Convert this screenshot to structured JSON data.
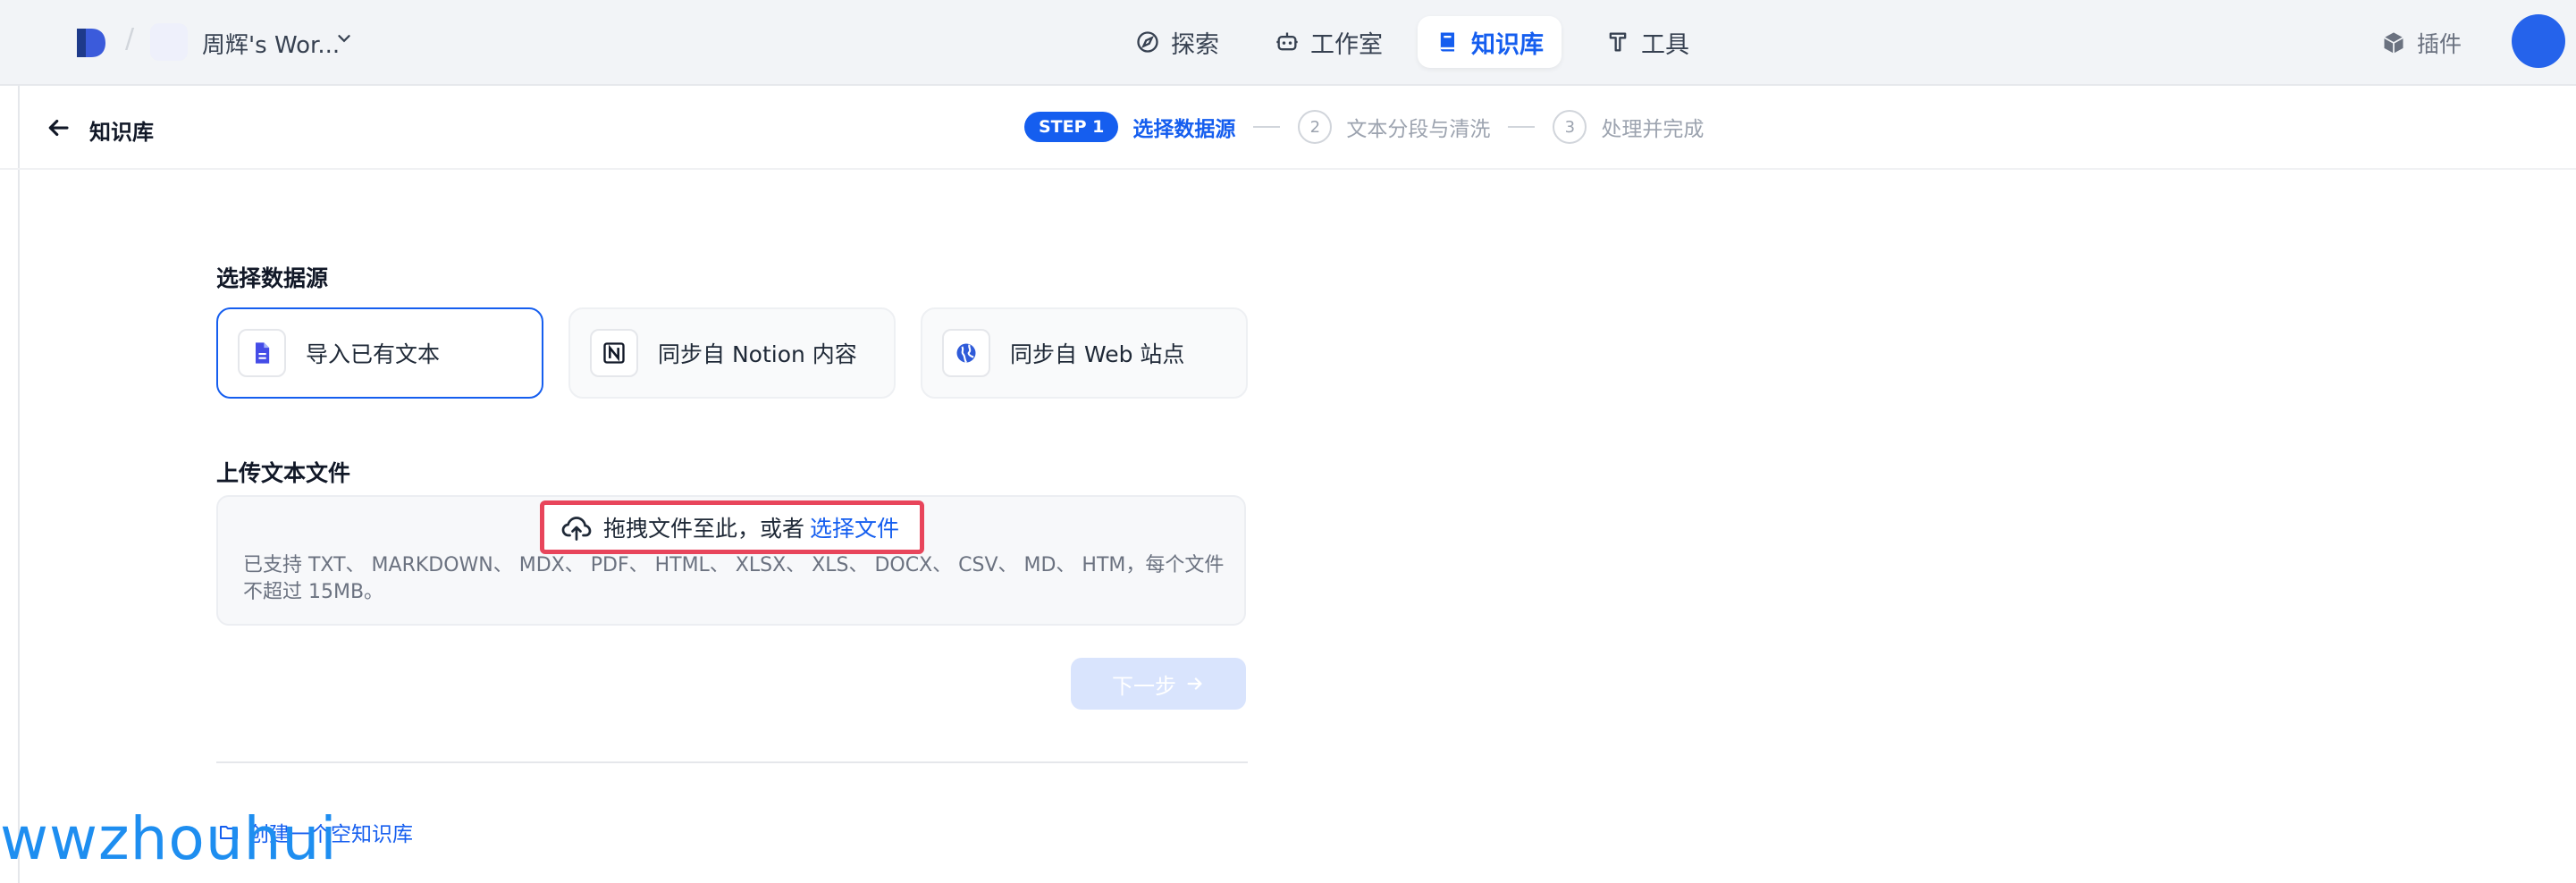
{
  "header": {
    "workspace_name": "周辉's Wor...",
    "nav": [
      {
        "label": "探索",
        "icon": "compass-icon"
      },
      {
        "label": "工作室",
        "icon": "robot-icon"
      },
      {
        "label": "知识库",
        "icon": "book-icon",
        "active": true
      },
      {
        "label": "工具",
        "icon": "tools-icon"
      }
    ],
    "plugins_label": "插件",
    "accent": "#155eef"
  },
  "subheader": {
    "title": "知识库",
    "steps": {
      "active_pill": "STEP 1",
      "active_label": "选择数据源",
      "step2_num": "2",
      "step2_label": "文本分段与清洗",
      "step3_num": "3",
      "step3_label": "处理并完成"
    }
  },
  "main": {
    "source_label": "选择数据源",
    "sources": [
      {
        "label": "导入已有文本",
        "icon": "document-icon",
        "selected": true
      },
      {
        "label": "同步自 Notion 内容",
        "icon": "notion-icon",
        "selected": false
      },
      {
        "label": "同步自 Web 站点",
        "icon": "globe-icon",
        "selected": false
      }
    ],
    "upload_label": "上传文本文件",
    "drop_text": "拖拽文件至此，或者",
    "drop_link": "选择文件",
    "support_text": "已支持 TXT、 MARKDOWN、 MDX、 PDF、 HTML、 XLSX、 XLS、 DOCX、 CSV、 MD、 HTM，每个文件不超过 15MB。",
    "next_button": "下一步",
    "create_empty": "创建一个空知识库"
  },
  "watermark": "wwzhouhui"
}
